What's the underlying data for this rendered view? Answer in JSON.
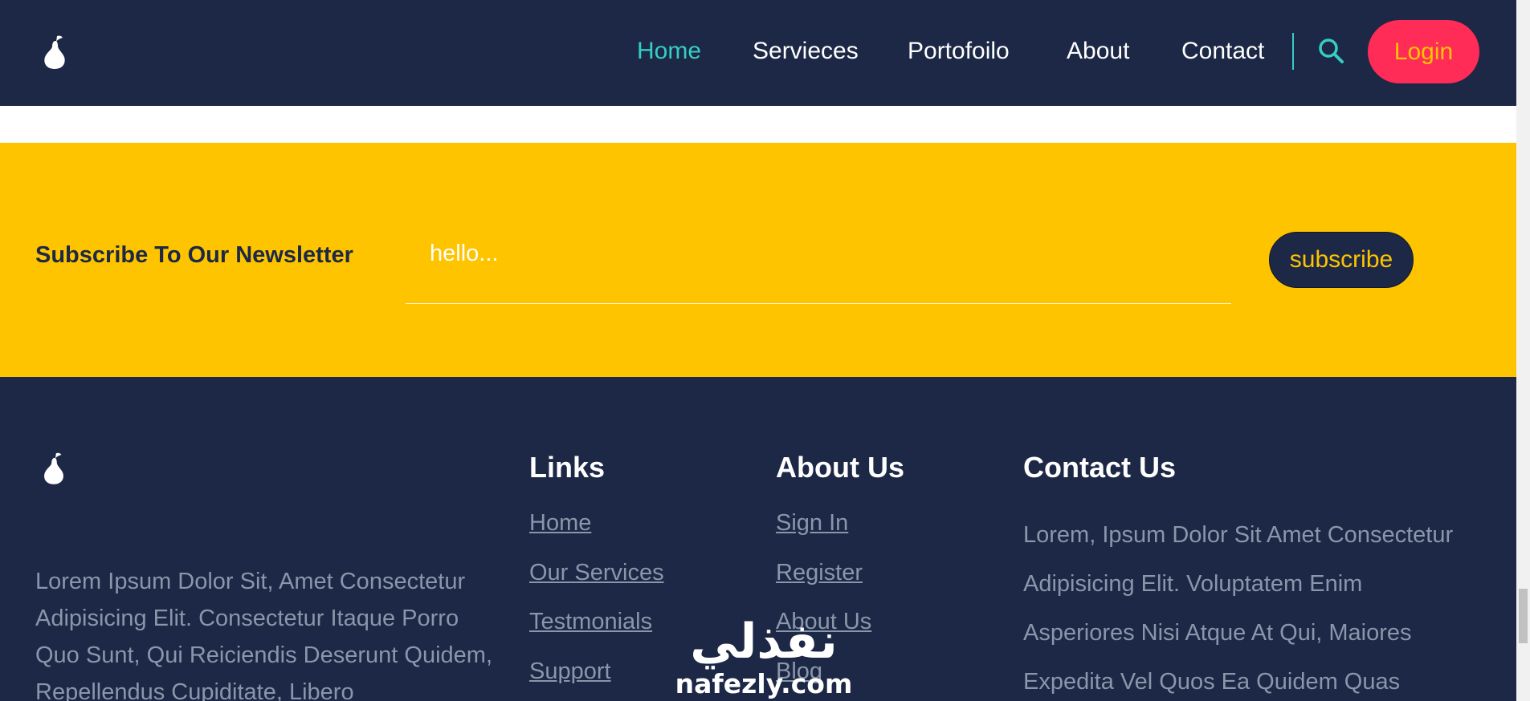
{
  "header": {
    "nav": [
      {
        "label": "Home",
        "active": true
      },
      {
        "label": "Servieces",
        "active": false
      },
      {
        "label": "Portofoilo",
        "active": false
      },
      {
        "label": "About",
        "active": false
      },
      {
        "label": "Contact",
        "active": false
      }
    ],
    "search_icon": "search-icon",
    "login_label": "Login"
  },
  "newsletter": {
    "title": "Subscribe To Our Newsletter",
    "input_placeholder": "hello...",
    "button_label": "subscribe"
  },
  "footer": {
    "description": "Lorem Ipsum Dolor Sit, Amet Consectetur Adipisicing Elit. Consectetur Itaque Porro Quo Sunt, Qui Reiciendis Deserunt Quidem, Repellendus Cupiditate, Libero",
    "links": {
      "heading": "Links",
      "items": [
        "Home",
        "Our Services",
        "Testmonials",
        "Support"
      ]
    },
    "about": {
      "heading": "About Us",
      "items": [
        "Sign In",
        "Register",
        "About Us",
        "Blog"
      ]
    },
    "contact": {
      "heading": "Contact Us",
      "lines": [
        "Lorem, Ipsum Dolor Sit Amet Consectetur",
        "Adipisicing Elit. Voluptatem Enim",
        "Asperiores Nisi Atque At Qui, Maiores",
        "Expedita Vel Quos Ea Quidem Quas"
      ]
    }
  },
  "watermark": {
    "arabic_text": "نفذلي",
    "latin_text": "nafezly.com"
  },
  "colors": {
    "navy": "#1c2846",
    "accent_teal": "#36cdc4",
    "yellow": "#fec400",
    "login_red": "#fe2c57",
    "muted_text": "#8a96a9"
  }
}
